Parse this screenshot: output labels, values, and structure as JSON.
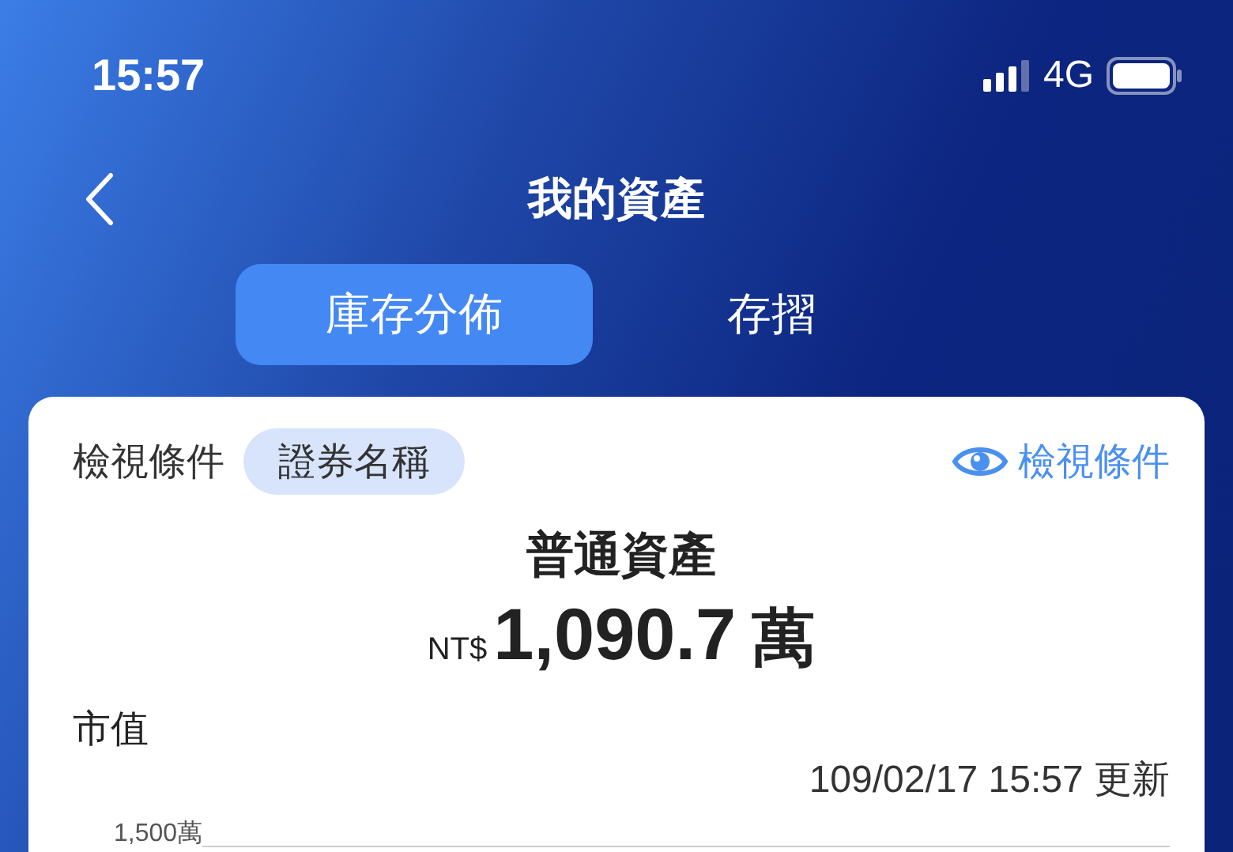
{
  "status_bar": {
    "time": "15:57",
    "network": "4G"
  },
  "nav": {
    "title": "我的資產"
  },
  "tabs": [
    {
      "label": "庫存分佈",
      "selected": true
    },
    {
      "label": "存摺",
      "selected": false
    }
  ],
  "filter": {
    "label": "檢視條件",
    "chip": "證券名稱",
    "action": "檢視條件"
  },
  "summary": {
    "title": "普通資產",
    "currency": "NT$",
    "amount": "1,090.7",
    "unit": "萬"
  },
  "market_value": {
    "label": "市值",
    "updated": "109/02/17 15:57 更新",
    "y_tick": "1,500萬"
  }
}
